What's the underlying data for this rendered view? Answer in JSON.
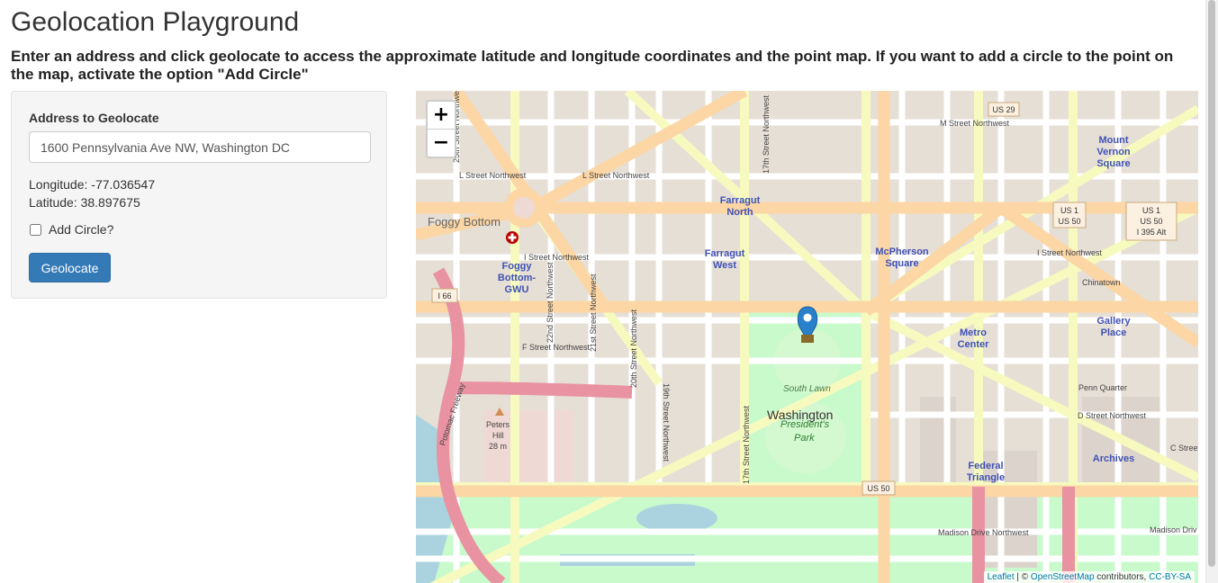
{
  "page": {
    "title": "Geolocation Playground",
    "intro": "Enter an address and click geolocate to access the approximate latitude and longitude coordinates and the point map. If you want to add a circle to the point on the map, activate the option \"Add Circle\""
  },
  "form": {
    "address_label": "Address to Geolocate",
    "address_value": "1600 Pennsylvania Ave NW, Washington DC",
    "longitude_text": "Longitude: -77.036547",
    "latitude_text": "Latitude: 38.897675",
    "add_circle_label": "Add Circle?",
    "add_circle_checked": false,
    "geolocate_label": "Geolocate"
  },
  "map": {
    "zoom_in": "+",
    "zoom_out": "−",
    "attribution": {
      "leaflet": "Leaflet",
      "sep": " | © ",
      "osm": "OpenStreetMap",
      "contributors": " contributors, ",
      "license": "CC-BY-SA"
    },
    "labels": {
      "washington": "Washington",
      "presidents_park_1": "President's",
      "presidents_park_2": "Park",
      "south_lawn": "South Lawn",
      "foggy_bottom": "Foggy Bottom",
      "foggy_gwu_1": "Foggy",
      "foggy_gwu_2": "Bottom-",
      "foggy_gwu_3": "GWU",
      "farragut_north_1": "Farragut",
      "farragut_north_2": "North",
      "farragut_west_1": "Farragut",
      "farragut_west_2": "West",
      "mcpherson_1": "McPherson",
      "mcpherson_2": "Square",
      "metro_center_1": "Metro",
      "metro_center_2": "Center",
      "federal_triangle_1": "Federal",
      "federal_triangle_2": "Triangle",
      "archives": "Archives",
      "gallery_place_1": "Gallery",
      "gallery_place_2": "Place",
      "mount_vernon_1": "Mount",
      "mount_vernon_2": "Vernon",
      "mount_vernon_3": "Square",
      "chinatown": "Chinatown",
      "penn_quarter": "Penn Quarter",
      "peters_hill_1": "Peters",
      "peters_hill_2": "Hill",
      "peters_hill_3": "28 m",
      "l_street": "L Street Northwest",
      "l_street_w": "L Street Northwest",
      "m_street": "M Street Northwest",
      "i_street_w": "I Street Northwest",
      "i_street_e": "I Street Northwest",
      "f_street": "F Street Northwest",
      "d_street": "D Street Northwest",
      "c_street": "C Street",
      "madison_1": "Madison Drive Northwest",
      "madison_2": "Madison Driv",
      "st17": "17th Street Northwest",
      "st17b": "17th Street Northwest",
      "st19": "19th Street Northwest",
      "st20": "20th Street Northwest",
      "st21": "21st Street Northwest",
      "st22": "22nd Street Northwest",
      "st25": "25th Street Northwest",
      "potomac": "Potomac Freeway",
      "us29": "US 29",
      "us1_us50_a": "US 1",
      "us1_us50_b": "US 50",
      "us1_us50_395_a": "US 1",
      "us1_us50_395_b": "US 50",
      "us1_us50_395_c": "I 395 Alt",
      "i66": "I 66",
      "us50": "US 50"
    }
  },
  "colors": {
    "primary_button": "#337ab7",
    "marker": "#2a81cb",
    "park": "#c8facc",
    "water": "#aad3df",
    "major_road": "#fcd6a4",
    "secondary_road": "#f7fabf",
    "highway": "#e892a2",
    "label_blue": "#3f51b5"
  }
}
